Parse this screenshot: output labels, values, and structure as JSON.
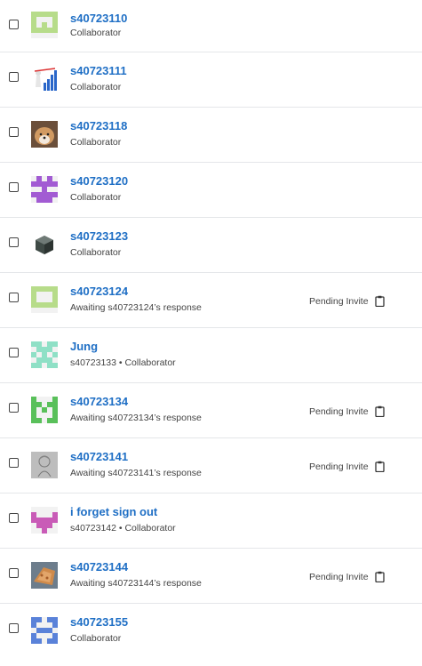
{
  "members": [
    {
      "name": "s40723110",
      "sub": "Collaborator",
      "pending": "",
      "avatar": "identicon-icon",
      "color": "#b7dc8a"
    },
    {
      "name": "s40723111",
      "sub": "Collaborator",
      "pending": "",
      "avatar": "bar-chart-figure-icon",
      "color": "#2a66c9"
    },
    {
      "name": "s40723118",
      "sub": "Collaborator",
      "pending": "",
      "avatar": "dog-photo-icon",
      "color": "#b5895e"
    },
    {
      "name": "s40723120",
      "sub": "Collaborator",
      "pending": "",
      "avatar": "identicon-icon",
      "color": "#a25bd3"
    },
    {
      "name": "s40723123",
      "sub": "Collaborator",
      "pending": "",
      "avatar": "cube-icon",
      "color": "#3f4a46"
    },
    {
      "name": "s40723124",
      "sub": "Awaiting s40723124’s response",
      "pending": "Pending Invite",
      "avatar": "identicon-icon",
      "color": "#b7dc8a"
    },
    {
      "name": "Jung",
      "sub": "s40723133 • Collaborator",
      "pending": "",
      "avatar": "identicon-icon",
      "color": "#8fe0c6"
    },
    {
      "name": "s40723134",
      "sub": "Awaiting s40723134’s response",
      "pending": "Pending Invite",
      "avatar": "identicon-icon",
      "color": "#59c05a"
    },
    {
      "name": "s40723141",
      "sub": "Awaiting s40723141’s response",
      "pending": "Pending Invite",
      "avatar": "sketch-photo-icon",
      "color": "#9a9a9a"
    },
    {
      "name": "i forget sign out",
      "sub": "s40723142 • Collaborator",
      "pending": "",
      "avatar": "identicon-icon",
      "color": "#c95bb7"
    },
    {
      "name": "s40723144",
      "sub": "Awaiting s40723144’s response",
      "pending": "Pending Invite",
      "avatar": "food-photo-icon",
      "color": "#cf8a4a"
    },
    {
      "name": "s40723155",
      "sub": "Collaborator",
      "pending": "",
      "avatar": "identicon-icon",
      "color": "#5a82d9"
    }
  ]
}
